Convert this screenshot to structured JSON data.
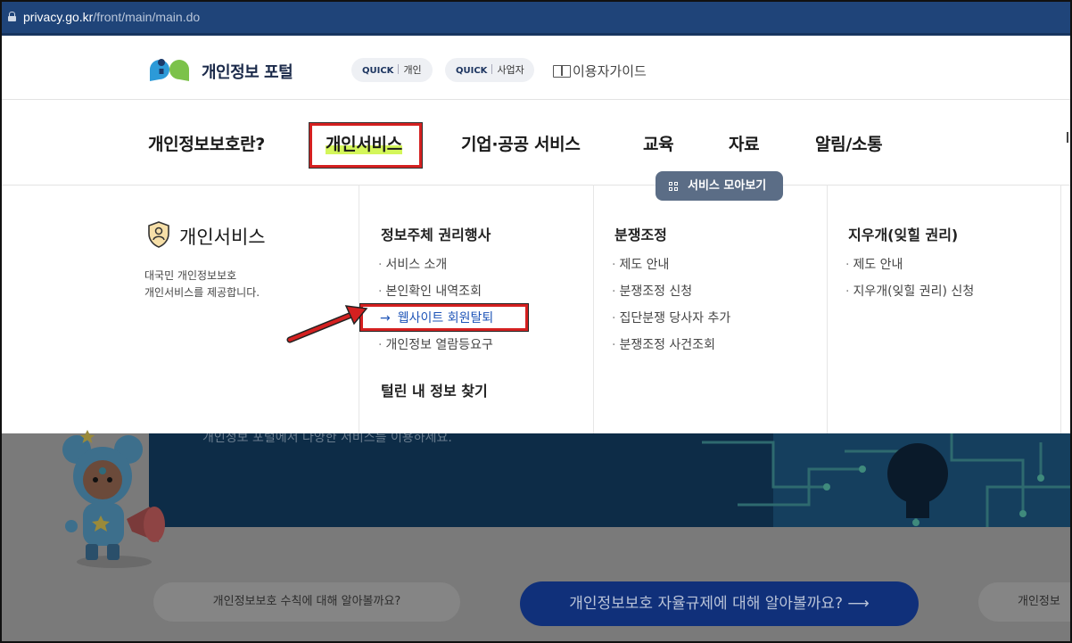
{
  "browser": {
    "url_host": "privacy.go.kr",
    "url_path": "/front/main/main.do"
  },
  "header": {
    "logo_text": "개인정보 포털",
    "quick_personal": {
      "prefix": "QUICK",
      "label": "개인"
    },
    "quick_business": {
      "prefix": "QUICK",
      "label": "사업자"
    },
    "user_guide": "이용자가이드"
  },
  "nav": {
    "items": [
      {
        "label": "개인정보보호란?"
      },
      {
        "label": "개인서비스",
        "active": true
      },
      {
        "label": "기업·공공 서비스"
      },
      {
        "label": "교육"
      },
      {
        "label": "자료"
      },
      {
        "label": "알림/소통"
      }
    ],
    "service_collection_button": "서비스 모아보기"
  },
  "panel": {
    "title": "개인서비스",
    "description_line1": "대국민 개인정보보호",
    "description_line2": "개인서비스를 제공합니다.",
    "columns": [
      {
        "heading": "정보주체 권리행사",
        "links": [
          "서비스 소개",
          "본인확인 내역조회",
          "웹사이트 회원탈퇴",
          "개인정보 열람등요구"
        ],
        "sub_heading": "털린 내 정보 찾기"
      },
      {
        "heading": "분쟁조정",
        "links": [
          "제도 안내",
          "분쟁조정 신청",
          "집단분쟁 당사자 추가",
          "분쟁조정 사건조회"
        ]
      },
      {
        "heading": "지우개(잊힐 권리)",
        "links": [
          "제도 안내",
          "지우개(잊힐 권리) 신청"
        ]
      }
    ],
    "highlighted_link": "웹사이트 회원탈퇴"
  },
  "background": {
    "banner_text": "개인정보 포털에서 다양한 서비스를 이용하세요.",
    "cta_left": "개인정보보호 수칙에 대해 알아볼까요?",
    "cta_main": "개인정보보호 자율규제에 대해 알아볼까요?",
    "cta_right": "개인정보"
  },
  "colors": {
    "address_bar": "#1f4479",
    "highlight": "#d4f65a",
    "annotation_red": "#d42020",
    "link_blue": "#1e54b7",
    "service_button": "#5b6d86"
  }
}
